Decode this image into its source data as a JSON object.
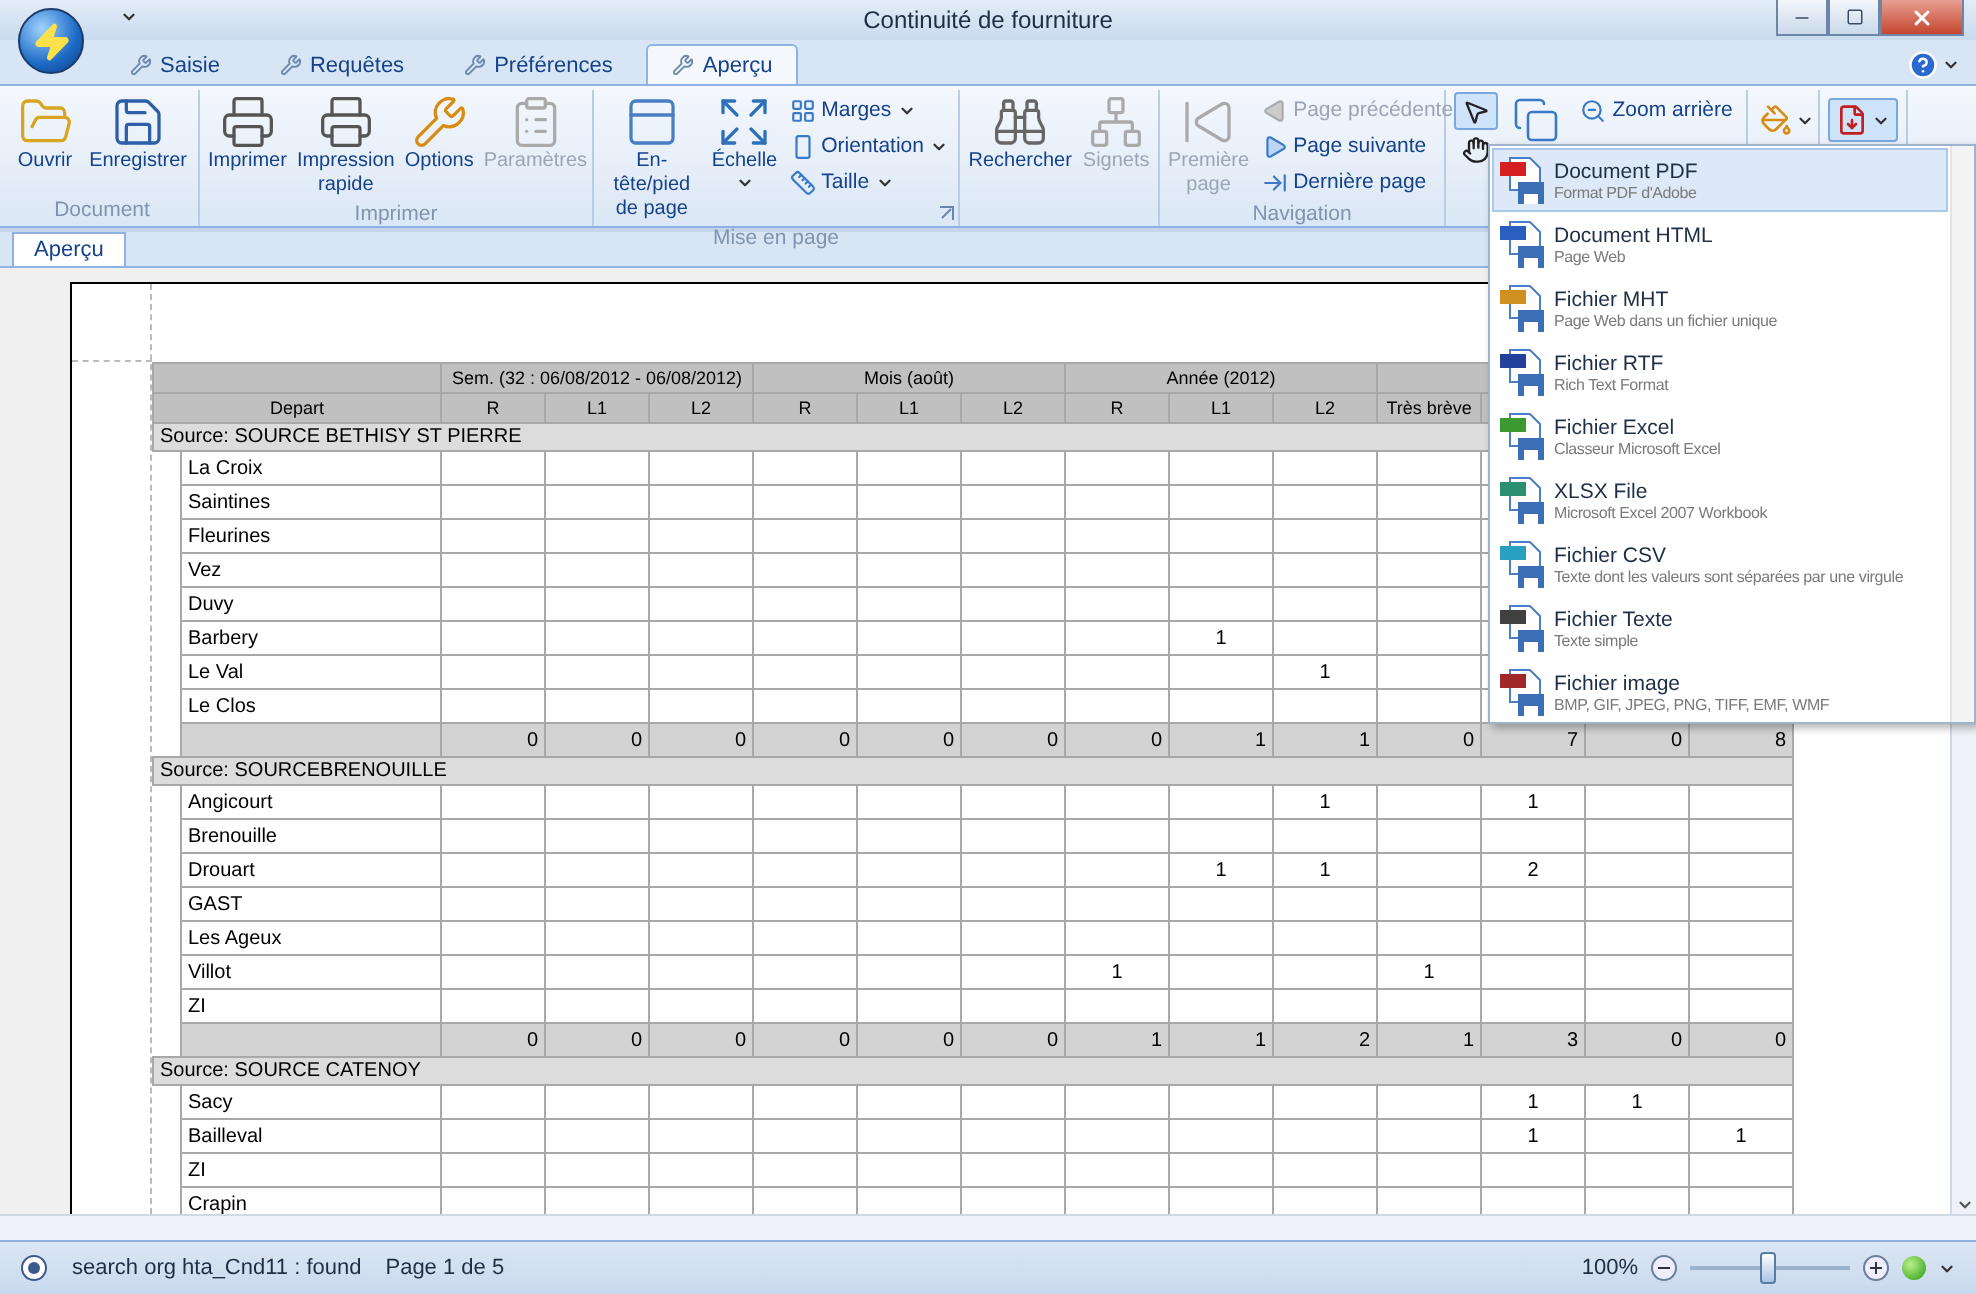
{
  "window": {
    "title": "Continuité de fourniture"
  },
  "app_tabs": [
    {
      "label": "Saisie",
      "selected": false
    },
    {
      "label": "Requêtes",
      "selected": false
    },
    {
      "label": "Préférences",
      "selected": false
    },
    {
      "label": "Aperçu",
      "selected": true
    }
  ],
  "ribbon": {
    "groups": [
      {
        "label": "Document",
        "items": [
          {
            "kind": "large",
            "label": "Ouvrir",
            "disabled": false
          },
          {
            "kind": "large",
            "label": "Enregistrer",
            "disabled": false
          }
        ]
      },
      {
        "label": "Imprimer",
        "items": [
          {
            "kind": "large",
            "label": "Imprimer",
            "disabled": false
          },
          {
            "kind": "large",
            "label": "Impression rapide",
            "disabled": false
          },
          {
            "kind": "large",
            "label": "Options",
            "disabled": false
          },
          {
            "kind": "large",
            "label": "Paramètres",
            "disabled": true
          }
        ]
      },
      {
        "label": "Mise en page",
        "launcher": true,
        "items": [
          {
            "kind": "large",
            "label": "En-tête/pied de page",
            "disabled": false
          },
          {
            "kind": "large",
            "label": "Échelle",
            "disabled": false,
            "dropdown": true
          },
          {
            "kind": "small",
            "label": "Marges",
            "disabled": false,
            "dropdown": true
          },
          {
            "kind": "small",
            "label": "Orientation",
            "disabled": false,
            "dropdown": true
          },
          {
            "kind": "small",
            "label": "Taille",
            "disabled": false,
            "dropdown": true
          }
        ]
      },
      {
        "items": [
          {
            "kind": "large",
            "label": "Rechercher",
            "disabled": false
          },
          {
            "kind": "large",
            "label": "Signets",
            "disabled": true
          }
        ]
      },
      {
        "label": "Navigation",
        "items": [
          {
            "kind": "large",
            "label": "Première page",
            "disabled": true
          },
          {
            "kind": "small",
            "label": "Page précédente",
            "disabled": true
          },
          {
            "kind": "small",
            "label": "Page suivante",
            "disabled": false
          },
          {
            "kind": "small",
            "label": "Dernière page",
            "disabled": false
          }
        ]
      },
      {
        "items": [
          {
            "kind": "tool",
            "selected": true
          },
          {
            "kind": "tool",
            "selected": false
          },
          {
            "kind": "icon",
            "selected": false
          },
          {
            "kind": "small",
            "label": "Zoom arrière",
            "disabled": false
          }
        ]
      },
      {
        "items": [
          {
            "kind": "split",
            "expanded": false
          }
        ]
      },
      {
        "items": [
          {
            "kind": "split",
            "expanded": true
          }
        ]
      }
    ]
  },
  "doc_tabs": [
    {
      "label": "Aperçu",
      "selected": true
    }
  ],
  "report": {
    "group_headers": [
      "Sem. (32 : 06/08/2012 - 06/08/2012)",
      "Mois (août)",
      "Année (2012)"
    ],
    "column_headers": [
      "Depart",
      "R",
      "L1",
      "L2",
      "R",
      "L1",
      "L2",
      "R",
      "L1",
      "L2",
      "Très brève"
    ],
    "sections": [
      {
        "title": "Source: SOURCE BETHISY ST PIERRE",
        "rows": [
          {
            "name": "La Croix",
            "cells": [
              null,
              null,
              null,
              null,
              null,
              null,
              null,
              null,
              null,
              null,
              null,
              null,
              null
            ]
          },
          {
            "name": "Saintines",
            "cells": [
              null,
              null,
              null,
              null,
              null,
              null,
              null,
              null,
              null,
              null,
              null,
              null,
              null
            ]
          },
          {
            "name": "Fleurines",
            "cells": [
              null,
              null,
              null,
              null,
              null,
              null,
              null,
              null,
              null,
              null,
              null,
              null,
              null
            ]
          },
          {
            "name": "Vez",
            "cells": [
              null,
              null,
              null,
              null,
              null,
              null,
              null,
              null,
              null,
              null,
              null,
              null,
              null
            ]
          },
          {
            "name": "Duvy",
            "cells": [
              null,
              null,
              null,
              null,
              null,
              null,
              null,
              null,
              null,
              null,
              null,
              null,
              null
            ]
          },
          {
            "name": "Barbery",
            "cells": [
              null,
              null,
              null,
              null,
              null,
              null,
              null,
              "1",
              null,
              null,
              null,
              null,
              null
            ]
          },
          {
            "name": "Le Val",
            "cells": [
              null,
              null,
              null,
              null,
              null,
              null,
              null,
              null,
              "1",
              null,
              null,
              null,
              null
            ]
          },
          {
            "name": "Le Clos",
            "cells": [
              null,
              null,
              null,
              null,
              null,
              null,
              null,
              null,
              null,
              null,
              null,
              null,
              null
            ]
          }
        ],
        "totals": [
          "0",
          "0",
          "0",
          "0",
          "0",
          "0",
          "0",
          "1",
          "1",
          "0",
          "7",
          "0",
          "8"
        ]
      },
      {
        "title": "Source: SOURCEBRENOUILLE",
        "rows": [
          {
            "name": "Angicourt",
            "cells": [
              null,
              null,
              null,
              null,
              null,
              null,
              null,
              null,
              "1",
              null,
              "1",
              null,
              null
            ]
          },
          {
            "name": "Brenouille",
            "cells": [
              null,
              null,
              null,
              null,
              null,
              null,
              null,
              null,
              null,
              null,
              null,
              null,
              null
            ]
          },
          {
            "name": "Drouart",
            "cells": [
              null,
              null,
              null,
              null,
              null,
              null,
              null,
              "1",
              "1",
              null,
              "2",
              null,
              null
            ]
          },
          {
            "name": "GAST",
            "cells": [
              null,
              null,
              null,
              null,
              null,
              null,
              null,
              null,
              null,
              null,
              null,
              null,
              null
            ]
          },
          {
            "name": "Les Ageux",
            "cells": [
              null,
              null,
              null,
              null,
              null,
              null,
              null,
              null,
              null,
              null,
              null,
              null,
              null
            ]
          },
          {
            "name": "Villot",
            "cells": [
              null,
              null,
              null,
              null,
              null,
              null,
              "1",
              null,
              null,
              "1",
              null,
              null,
              null
            ]
          },
          {
            "name": "ZI",
            "cells": [
              null,
              null,
              null,
              null,
              null,
              null,
              null,
              null,
              null,
              null,
              null,
              null,
              null
            ]
          }
        ],
        "totals": [
          "0",
          "0",
          "0",
          "0",
          "0",
          "0",
          "1",
          "1",
          "2",
          "1",
          "3",
          "0",
          "0"
        ]
      },
      {
        "title": "Source: SOURCE CATENOY",
        "rows": [
          {
            "name": "Sacy",
            "cells": [
              null,
              null,
              null,
              null,
              null,
              null,
              null,
              null,
              null,
              null,
              "1",
              "1",
              null
            ]
          },
          {
            "name": "Bailleval",
            "cells": [
              null,
              null,
              null,
              null,
              null,
              null,
              null,
              null,
              null,
              null,
              "1",
              null,
              "1"
            ]
          },
          {
            "name": "ZI",
            "cells": [
              null,
              null,
              null,
              null,
              null,
              null,
              null,
              null,
              null,
              null,
              null,
              null,
              null
            ]
          },
          {
            "name": "Crapin",
            "cells": [
              null,
              null,
              null,
              null,
              null,
              null,
              null,
              null,
              null,
              null,
              null,
              null,
              null
            ]
          }
        ]
      }
    ]
  },
  "export_menu": [
    {
      "title": "Document PDF",
      "description": "Format PDF d'Adobe",
      "color": "#d42020",
      "selected": true
    },
    {
      "title": "Document HTML",
      "description": "Page Web",
      "color": "#2a5fc0",
      "selected": false
    },
    {
      "title": "Fichier MHT",
      "description": "Page Web dans un fichier unique",
      "color": "#d09020",
      "selected": false
    },
    {
      "title": "Fichier RTF",
      "description": "Rich Text Format",
      "color": "#23409a",
      "selected": false
    },
    {
      "title": "Fichier Excel",
      "description": "Classeur Microsoft Excel",
      "color": "#3a9a30",
      "selected": false
    },
    {
      "title": "XLSX File",
      "description": "Microsoft Excel 2007 Workbook",
      "color": "#2a9070",
      "selected": false
    },
    {
      "title": "Fichier CSV",
      "description": "Texte dont les valeurs sont séparées par une virgule",
      "color": "#2aa0c0",
      "selected": false
    },
    {
      "title": "Fichier Texte",
      "description": "Texte simple",
      "color": "#404040",
      "selected": false
    },
    {
      "title": "Fichier image",
      "description": "BMP, GIF, JPEG, PNG, TIFF, EMF, WMF",
      "color": "#a02828",
      "selected": false
    }
  ],
  "status_bar": {
    "message": "search org hta_Cnd11 : found",
    "page": "Page 1 de 5",
    "zoom": "100%",
    "zoom_level": {
      "level": 0.49
    }
  }
}
